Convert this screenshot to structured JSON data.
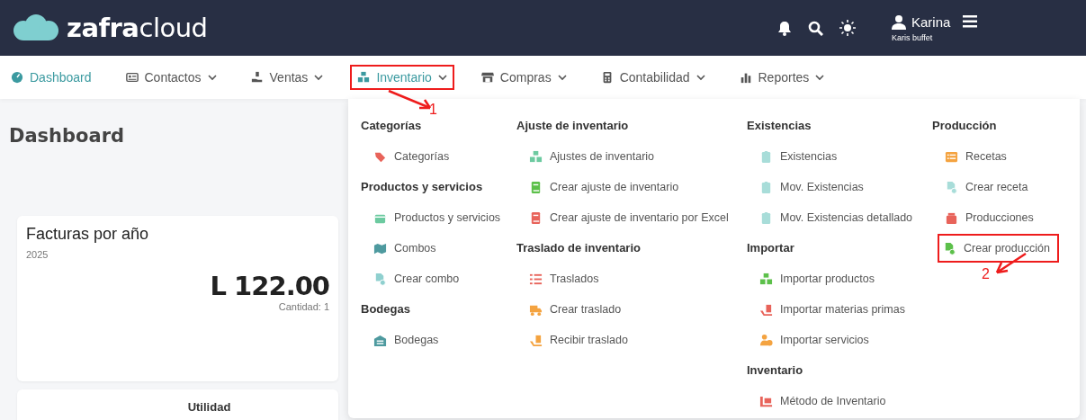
{
  "header": {
    "logo": "**zafra**cloud",
    "user_name": "Karina",
    "company": "Karis buffet"
  },
  "nav": [
    {
      "label": "Dashboard",
      "selected": true,
      "expanded": false,
      "dropdown": false,
      "highlighted": false
    },
    {
      "label": "Contactos",
      "selected": false,
      "expanded": false,
      "dropdown": true,
      "highlighted": false
    },
    {
      "label": "Ventas",
      "selected": false,
      "expanded": false,
      "dropdown": true,
      "highlighted": false
    },
    {
      "label": "Inventario",
      "selected": false,
      "expanded": true,
      "dropdown": true,
      "highlighted": true
    },
    {
      "label": "Compras",
      "selected": false,
      "expanded": false,
      "dropdown": true,
      "highlighted": false
    },
    {
      "label": "Contabilidad",
      "selected": false,
      "expanded": false,
      "dropdown": true,
      "highlighted": false
    },
    {
      "label": "Reportes",
      "selected": false,
      "expanded": false,
      "dropdown": true,
      "highlighted": false
    }
  ],
  "page_title": "Dashboard",
  "cards": [
    {
      "title": "Facturas por año",
      "subtitle": "2025",
      "amount": "L 122.00",
      "count": "Cantidad: 1"
    },
    {
      "title": "Utilidad"
    }
  ],
  "menu": {
    "columns": [
      [
        {
          "heading": "Categorías",
          "items": [
            {
              "label": "Categorías",
              "color": "#e8635a",
              "highlighted": false
            }
          ]
        },
        {
          "heading": "Productos y servicios",
          "items": [
            {
              "label": "Productos y servicios",
              "color": "#6ccaa0",
              "highlighted": false
            },
            {
              "label": "Combos",
              "color": "#4e9a9f",
              "highlighted": false
            },
            {
              "label": "Crear combo",
              "color": "#8fd0cf",
              "highlighted": false
            }
          ]
        },
        {
          "heading": "Bodegas",
          "items": [
            {
              "label": "Bodegas",
              "color": "#4e9a9f",
              "highlighted": false
            }
          ]
        }
      ],
      [
        {
          "heading": "Ajuste de inventario",
          "items": [
            {
              "label": "Ajustes de inventario",
              "color": "#6ccaa0",
              "highlighted": false
            },
            {
              "label": "Crear ajuste de inventario",
              "color": "#5cc04a",
              "highlighted": false
            },
            {
              "label": "Crear ajuste de inventario por Excel",
              "color": "#e8635a",
              "highlighted": false
            }
          ]
        },
        {
          "heading": "Traslado de inventario",
          "items": [
            {
              "label": "Traslados",
              "color": "#e8635a",
              "highlighted": false
            },
            {
              "label": "Crear traslado",
              "color": "#f4a340",
              "highlighted": false
            },
            {
              "label": "Recibir traslado",
              "color": "#f4a340",
              "highlighted": false
            }
          ]
        }
      ],
      [
        {
          "heading": "Existencias",
          "items": [
            {
              "label": "Existencias",
              "color": "#a8ddd9",
              "highlighted": false
            },
            {
              "label": "Mov. Existencias",
              "color": "#a8ddd9",
              "highlighted": false
            },
            {
              "label": "Mov. Existencias detallado",
              "color": "#a8ddd9",
              "highlighted": false
            }
          ]
        },
        {
          "heading": "Importar",
          "items": [
            {
              "label": "Importar productos",
              "color": "#5cc04a",
              "highlighted": false
            },
            {
              "label": "Importar materias primas",
              "color": "#e8635a",
              "highlighted": false
            },
            {
              "label": "Importar servicios",
              "color": "#f4a340",
              "highlighted": false
            }
          ]
        },
        {
          "heading": "Inventario",
          "items": [
            {
              "label": "Método de Inventario",
              "color": "#e8635a",
              "highlighted": false
            }
          ]
        }
      ],
      [
        {
          "heading": "Producción",
          "items": [
            {
              "label": "Recetas",
              "color": "#f4a340",
              "highlighted": false
            },
            {
              "label": "Crear receta",
              "color": "#a8ddd9",
              "highlighted": false
            },
            {
              "label": "Producciones",
              "color": "#e8635a",
              "highlighted": false
            },
            {
              "label": "Crear producción",
              "color": "#5cc04a",
              "highlighted": true
            }
          ]
        }
      ]
    ]
  },
  "annotations": [
    {
      "label": "1"
    },
    {
      "label": "2"
    }
  ]
}
